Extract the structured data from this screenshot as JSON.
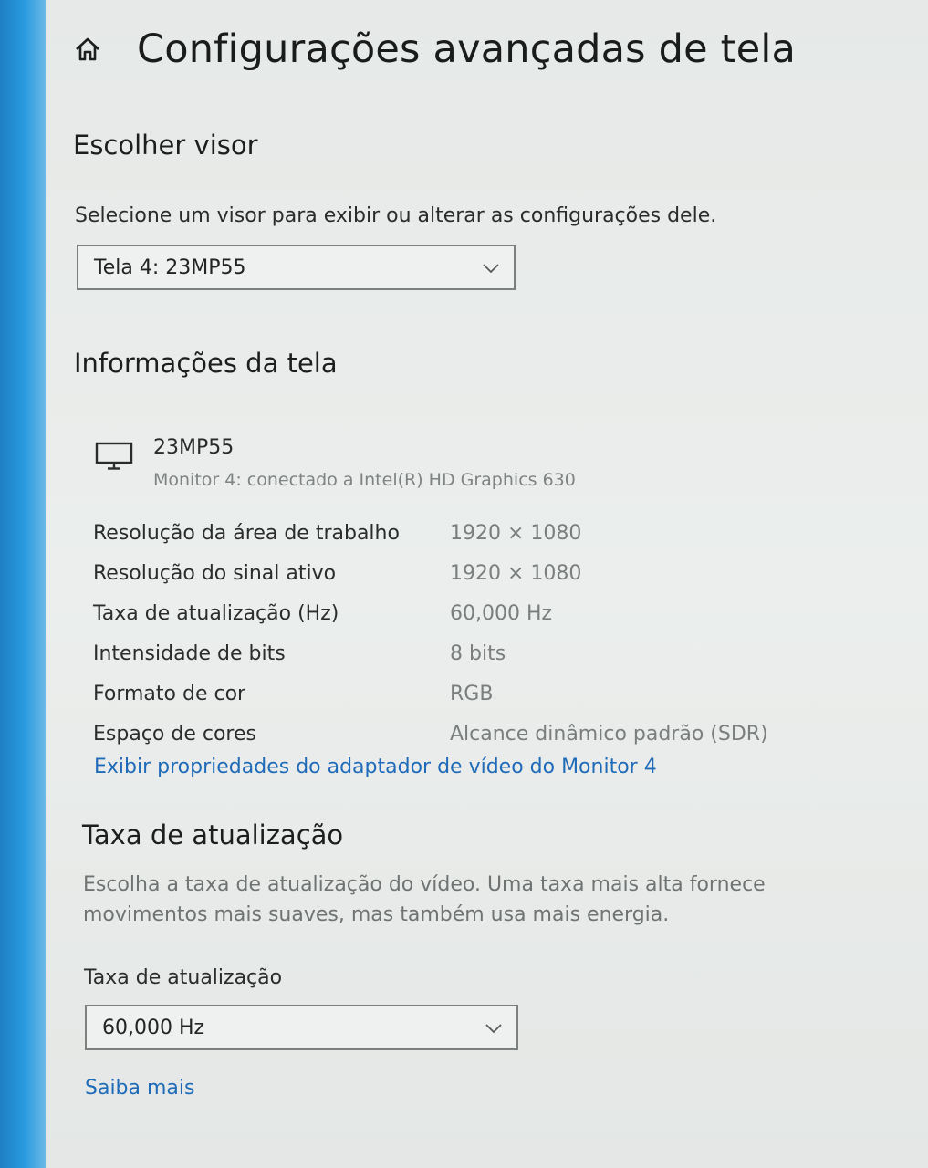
{
  "header": {
    "title": "Configurações avançadas de tela"
  },
  "choose_display": {
    "title": "Escolher visor",
    "description": "Selecione um visor para exibir ou alterar as configurações dele.",
    "selected": "Tela 4: 23MP55"
  },
  "display_info": {
    "title": "Informações da tela",
    "monitor_name": "23MP55",
    "monitor_subtitle": "Monitor 4: conectado a Intel(R) HD Graphics 630",
    "rows": [
      {
        "label": "Resolução da área de trabalho",
        "value": "1920 × 1080"
      },
      {
        "label": "Resolução do sinal ativo",
        "value": "1920 × 1080"
      },
      {
        "label": "Taxa de atualização (Hz)",
        "value": "60,000 Hz"
      },
      {
        "label": "Intensidade de bits",
        "value": "8 bits"
      },
      {
        "label": "Formato de cor",
        "value": "RGB"
      },
      {
        "label": "Espaço de cores",
        "value": "Alcance dinâmico padrão (SDR)"
      }
    ],
    "adapter_link": "Exibir propriedades do adaptador de vídeo do Monitor 4"
  },
  "refresh_rate": {
    "title": "Taxa de atualização",
    "description": "Escolha a taxa de atualização do vídeo. Uma taxa mais alta fornece movimentos mais suaves, mas também usa mais energia.",
    "field_label": "Taxa de atualização",
    "selected": "60,000 Hz",
    "learn_more": "Saiba mais"
  },
  "icons": {
    "home": "home-icon",
    "monitor": "monitor-icon",
    "dropdown": "chevron-down-icon"
  },
  "colors": {
    "accent_link": "#1f6bb8",
    "taskbar_blue": "#2a9be0"
  }
}
